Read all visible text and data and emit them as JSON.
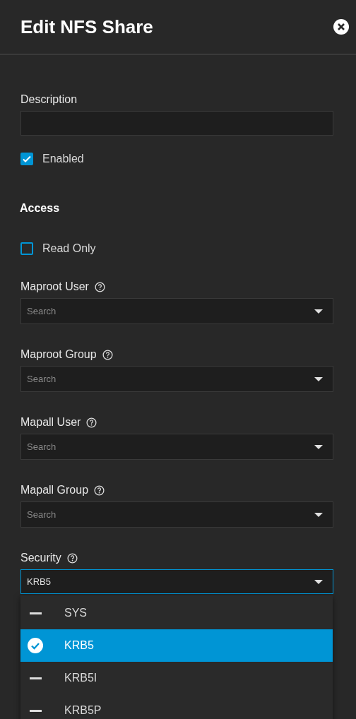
{
  "window": {
    "title": "Edit NFS Share"
  },
  "sections": [
    {
      "fields": [
        {
          "kind": "text",
          "label": "Description"
        },
        {
          "kind": "checkbox",
          "label": "Enabled",
          "checked": true
        }
      ]
    },
    {
      "heading": "Access",
      "fields": [
        {
          "kind": "checkbox",
          "label": "Read Only",
          "checked": false
        },
        {
          "kind": "combo",
          "label": "Maproot User",
          "help": true,
          "placeholder": "Search"
        },
        {
          "kind": "combo",
          "label": "Maproot Group",
          "help": true,
          "placeholder": "Search"
        },
        {
          "kind": "combo",
          "label": "Mapall User",
          "help": true,
          "placeholder": "Search"
        },
        {
          "kind": "combo",
          "label": "Mapall Group",
          "help": true,
          "placeholder": "Search"
        },
        {
          "kind": "select",
          "label": "Security",
          "help": true,
          "value": "KRB5",
          "expanded": true,
          "options": [
            {
              "label": "SYS",
              "selected": false
            },
            {
              "label": "KRB5",
              "selected": true
            },
            {
              "label": "KRB5I",
              "selected": false
            },
            {
              "label": "KRB5P",
              "selected": false
            }
          ]
        }
      ]
    }
  ]
}
